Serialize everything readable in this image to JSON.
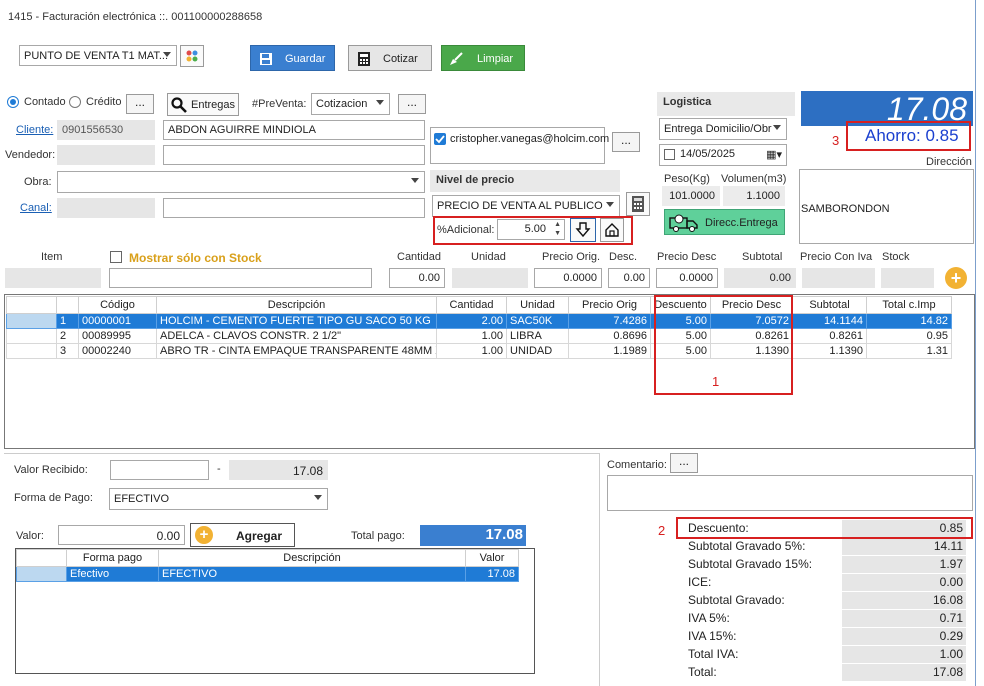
{
  "window": {
    "title": "1415 - Facturación electrónica ::. 001100000288658"
  },
  "toolbar": {
    "punto_venta": "PUNTO DE VENTA T1 MAT...",
    "guardar": "Guardar",
    "cotizar": "Cotizar",
    "limpiar": "Limpiar"
  },
  "form": {
    "contado": "Contado",
    "credito": "Crédito",
    "entregas": "Entregas",
    "prefix_preventa": "#PreVenta:",
    "preventa_value": "Cotizacion",
    "cliente_label": "Cliente:",
    "cliente_id": "0901556530",
    "cliente_name": "ABDON AGUIRRE MINDIOLA",
    "vendedor_label": "Vendedor:",
    "obra_label": "Obra:",
    "canal_label": "Canal:",
    "email": "cristopher.vanegas@holcim.com",
    "nivel_header": "Nivel de precio",
    "nivel_value": "PRECIO DE VENTA AL PUBLICO",
    "adicional_label": "%Adicional:",
    "adicional_value": "5.00"
  },
  "logistica": {
    "header": "Logistica",
    "tipo": "Entrega Domicilio/Obr",
    "fecha": "14/05/2025",
    "peso_label": "Peso(Kg)",
    "volumen_label": "Volumen(m3)",
    "peso": "101.0000",
    "volumen": "1.1000",
    "direcc_button": "Direcc.Entrega"
  },
  "totals_box": {
    "total": "17.08",
    "ahorro": "Ahorro: 0.85",
    "direccion_label": "Dirección",
    "direccion": "SAMBORONDON"
  },
  "entry": {
    "item_label": "Item",
    "stock_only": "Mostrar sólo con Stock",
    "cantidad_label": "Cantidad",
    "unidad_label": "Unidad",
    "precio_orig_label": "Precio Orig.",
    "desc_label": "Desc.",
    "precio_desc_label": "Precio Desc",
    "subtotal_label": "Subtotal",
    "precio_iva_label": "Precio Con Iva",
    "stock_label": "Stock",
    "cantidad": "0.00",
    "precio_orig": "0.0000",
    "desc": "0.00",
    "precio_desc": "0.0000",
    "subtotal": "0.00"
  },
  "items_table": {
    "columns": [
      "Código",
      "Descripción",
      "Cantidad",
      "Unidad",
      "Precio Orig",
      "Descuento",
      "Precio Desc",
      "Subtotal",
      "Total c.Imp"
    ],
    "rows": [
      {
        "n": "1",
        "codigo": "00000001",
        "desc": "HOLCIM  - CEMENTO FUERTE TIPO GU SACO 50 KG",
        "cant": "2.00",
        "unidad": "SAC50K",
        "porig": "7.4286",
        "descuento": "5.00",
        "pdesc": "7.0572",
        "subtotal": "14.1144",
        "total": "14.82"
      },
      {
        "n": "2",
        "codigo": "00089995",
        "desc": "ADELCA - CLAVOS CONSTR. 2 1/2\"",
        "cant": "1.00",
        "unidad": "LIBRA",
        "porig": "0.8696",
        "descuento": "5.00",
        "pdesc": "0.8261",
        "subtotal": "0.8261",
        "total": "0.95"
      },
      {
        "n": "3",
        "codigo": "00002240",
        "desc": "ABRO TR - CINTA EMPAQUE TRANSPARENTE 48MM X ...",
        "cant": "1.00",
        "unidad": "UNIDAD",
        "porig": "1.1989",
        "descuento": "5.00",
        "pdesc": "1.1390",
        "subtotal": "1.1390",
        "total": "1.31"
      }
    ]
  },
  "annotations": {
    "a1": "1",
    "a2": "2",
    "a3": "3"
  },
  "payment": {
    "valor_recibido_label": "Valor Recibido:",
    "dash": "-",
    "valor_recibido_total": "17.08",
    "forma_pago_label": "Forma de Pago:",
    "forma_pago_value": "EFECTIVO",
    "valor_label": "Valor:",
    "valor_value": "0.00",
    "agregar": "Agregar",
    "total_pago_label": "Total pago:",
    "total_pago": "17.08",
    "columns": [
      "Forma pago",
      "Descripción",
      "Valor"
    ],
    "rows": [
      {
        "forma": "Efectivo",
        "desc": "EFECTIVO",
        "valor": "17.08"
      }
    ]
  },
  "comentario_label": "Comentario:",
  "summary": [
    {
      "label": "Descuento:",
      "value": "0.85"
    },
    {
      "label": "Subtotal Gravado 5%:",
      "value": "14.11"
    },
    {
      "label": "Subtotal Gravado 15%:",
      "value": "1.97"
    },
    {
      "label": "ICE:",
      "value": "0.00"
    },
    {
      "label": "Subtotal Gravado:",
      "value": "16.08"
    },
    {
      "label": "IVA 5%:",
      "value": "0.71"
    },
    {
      "label": "IVA 15%:",
      "value": "0.29"
    },
    {
      "label": "Total IVA:",
      "value": "1.00"
    },
    {
      "label": "Total:",
      "value": "17.08"
    }
  ],
  "colors": {
    "accent": "#1f7bd6",
    "annotation": "#d72020",
    "save_btn": "#3a7fd0",
    "clean_btn": "#4aa84a"
  }
}
